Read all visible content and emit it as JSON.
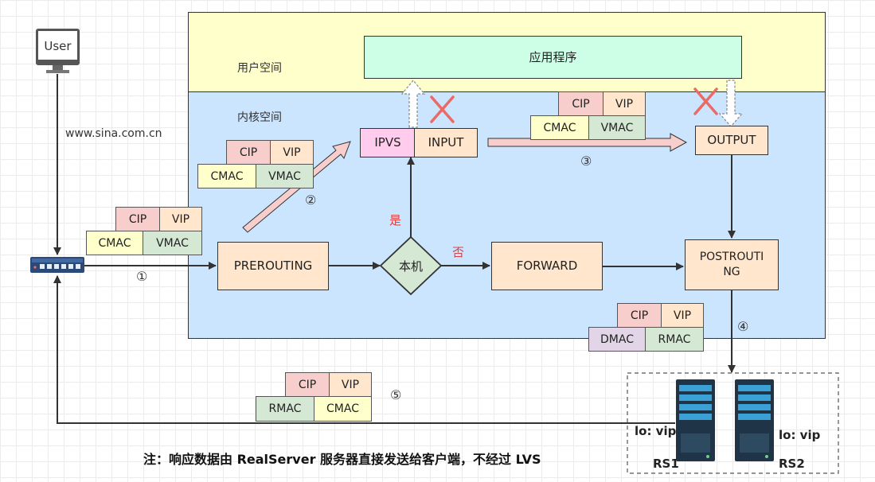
{
  "user": {
    "label": "User"
  },
  "url": "www.sina.com.cn",
  "zones": {
    "user_space": "用户空间",
    "kernel_space": "内核空间"
  },
  "boxes": {
    "app": "应用程序",
    "ipvs": "IPVS",
    "input": "INPUT",
    "output": "OUTPUT",
    "prerouting": "PREROUTING",
    "local": "本机",
    "forward": "FORWARD",
    "postrouting_line1": "POSTROUTI",
    "postrouting_line2": "NG"
  },
  "decisions": {
    "yes": "是",
    "no": "否"
  },
  "steps": {
    "s1": "①",
    "s2": "②",
    "s3": "③",
    "s4": "④",
    "s5": "⑤"
  },
  "packets": [
    {
      "cells": [
        "CIP",
        "VIP",
        "CMAC",
        "VMAC"
      ]
    },
    {
      "cells": [
        "CIP",
        "VIP",
        "CMAC",
        "VMAC"
      ]
    },
    {
      "cells": [
        "CIP",
        "VIP",
        "CMAC",
        "VMAC"
      ]
    },
    {
      "cells": [
        "CIP",
        "VIP",
        "DMAC",
        "RMAC"
      ]
    },
    {
      "cells": [
        "CIP",
        "VIP",
        "RMAC",
        "CMAC"
      ]
    }
  ],
  "servers": [
    {
      "lo": "lo: vip",
      "name": "RS1"
    },
    {
      "lo": "lo: vip",
      "name": "RS2"
    }
  ],
  "note": "注：响应数据由 RealServer 服务器直接发送给客户端，不经过 LVS",
  "colors": {
    "user_space": "#ffffcc",
    "kernel_space": "#cce5ff",
    "app": "#ccffe6",
    "ipvs": "#ffccee",
    "peach": "#ffe6cc",
    "cross": "#ea6b66"
  }
}
